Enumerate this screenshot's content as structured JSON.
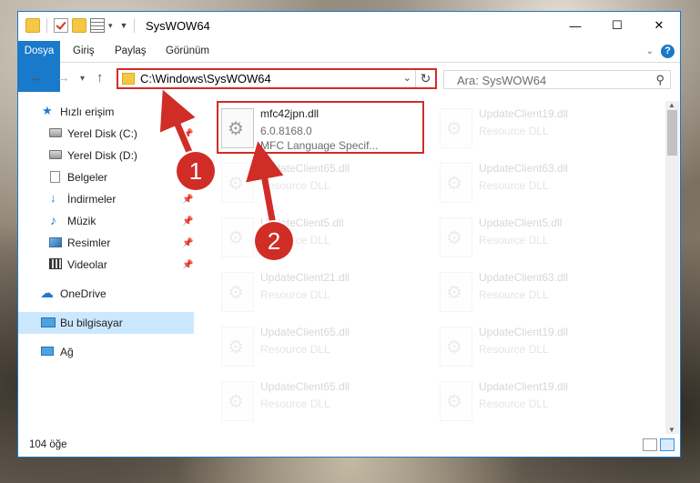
{
  "title_bar": {
    "title": "SysWOW64",
    "minimize_icon": "minimize-icon",
    "maximize_icon": "maximize-icon",
    "close_icon": "close-icon"
  },
  "ribbon": {
    "tabs": [
      "Dosya",
      "Giriş",
      "Paylaş",
      "Görünüm"
    ],
    "help_label": "?"
  },
  "navigation": {
    "address_path": "C:\\Windows\\SysWOW64",
    "search_placeholder": "Ara: SysWOW64"
  },
  "sidebar": {
    "items": [
      {
        "label": "Hızlı erişim",
        "icon": "star-icon"
      },
      {
        "label": "Yerel Disk (C:)",
        "icon": "disk-icon"
      },
      {
        "label": "Yerel Disk (D:)",
        "icon": "disk-icon"
      },
      {
        "label": "Belgeler",
        "icon": "document-icon"
      },
      {
        "label": "İndirmeler",
        "icon": "download-icon"
      },
      {
        "label": "Müzik",
        "icon": "music-icon"
      },
      {
        "label": "Resimler",
        "icon": "pictures-icon"
      },
      {
        "label": "Videolar",
        "icon": "video-icon"
      },
      {
        "label": "OneDrive",
        "icon": "cloud-icon"
      },
      {
        "label": "Bu bilgisayar",
        "icon": "pc-icon"
      },
      {
        "label": "Ağ",
        "icon": "network-icon"
      }
    ]
  },
  "files": {
    "highlighted": {
      "name": "mfc42jpn.dll",
      "version": "6.0.8168.0",
      "description": "MFC Language Specif..."
    },
    "others": [
      {
        "name": "UpdateClient19.dll",
        "type": "Resource DLL"
      },
      {
        "name": "UpdateClient65.dll",
        "type": "Resource DLL"
      },
      {
        "name": "UpdateClient63.dll",
        "type": "Resource DLL"
      },
      {
        "name": "UpdateClient5.dll",
        "type": "Resource DLL"
      },
      {
        "name": "UpdateClient5.dll",
        "type": "Resource DLL"
      },
      {
        "name": "UpdateClient21.dll",
        "type": "Resource DLL"
      },
      {
        "name": "UpdateClient63.dll",
        "type": "Resource DLL"
      },
      {
        "name": "UpdateClient65.dll",
        "type": "Resource DLL"
      },
      {
        "name": "UpdateClient19.dll",
        "type": "Resource DLL"
      },
      {
        "name": "UpdateClient65.dll",
        "type": "Resource DLL"
      },
      {
        "name": "UpdateClient19.dll",
        "type": "Resource DLL"
      }
    ]
  },
  "status_bar": {
    "item_count": "104 öğe"
  },
  "annotations": {
    "step1": "1",
    "step2": "2",
    "color": "#d02d26"
  },
  "colors": {
    "accent": "#1979ca",
    "highlight_box": "#d02d26",
    "selected_item_bg": "#cce8ff"
  }
}
